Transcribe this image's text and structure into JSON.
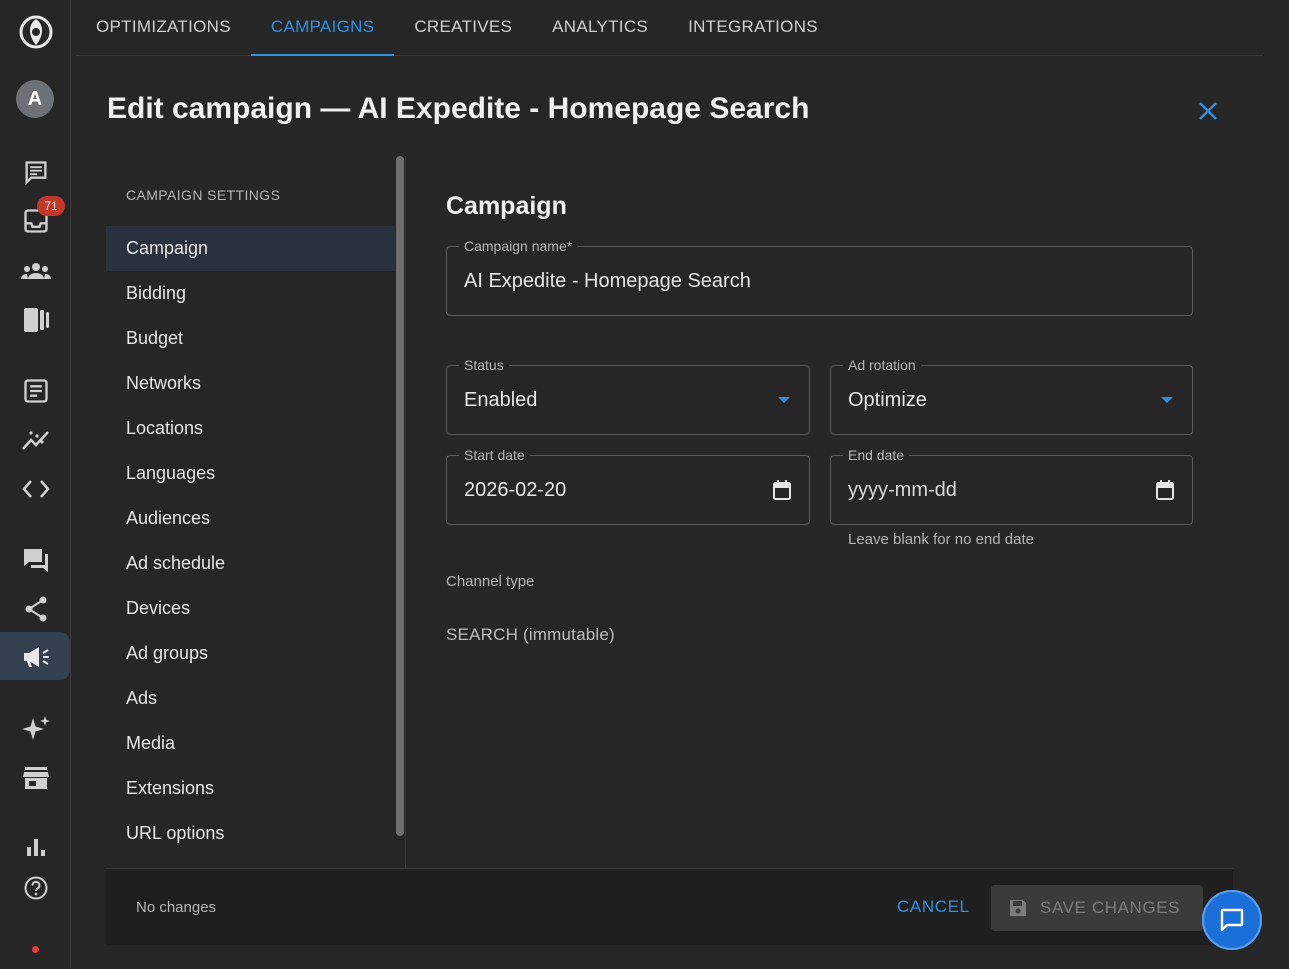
{
  "rail": {
    "avatar_letter": "A",
    "inbox_badge": "71"
  },
  "topnav": {
    "tabs": [
      {
        "label": "OPTIMIZATIONS"
      },
      {
        "label": "CAMPAIGNS"
      },
      {
        "label": "CREATIVES"
      },
      {
        "label": "ANALYTICS"
      },
      {
        "label": "INTEGRATIONS"
      }
    ],
    "active_tab": "CAMPAIGNS"
  },
  "page": {
    "title": "Edit campaign — AI Expedite - Homepage Search"
  },
  "menu": {
    "heading": "CAMPAIGN SETTINGS",
    "items": [
      {
        "label": "Campaign"
      },
      {
        "label": "Bidding"
      },
      {
        "label": "Budget"
      },
      {
        "label": "Networks"
      },
      {
        "label": "Locations"
      },
      {
        "label": "Languages"
      },
      {
        "label": "Audiences"
      },
      {
        "label": "Ad schedule"
      },
      {
        "label": "Devices"
      },
      {
        "label": "Ad groups"
      },
      {
        "label": "Ads"
      },
      {
        "label": "Media"
      },
      {
        "label": "Extensions"
      },
      {
        "label": "URL options"
      }
    ],
    "active_item": "Campaign"
  },
  "form": {
    "section_title": "Campaign",
    "campaign_name": {
      "label": "Campaign name*",
      "value": "AI Expedite - Homepage Search"
    },
    "status": {
      "label": "Status",
      "value": "Enabled"
    },
    "ad_rotation": {
      "label": "Ad rotation",
      "value": "Optimize"
    },
    "start_date": {
      "label": "Start date",
      "value": "2026-02-20"
    },
    "end_date": {
      "label": "End date",
      "placeholder": "yyyy-mm-dd",
      "helper": "Leave blank for no end date"
    },
    "channel_type": {
      "label": "Channel type",
      "value": "SEARCH (immutable)"
    }
  },
  "footer": {
    "status": "No changes",
    "cancel_label": "CANCEL",
    "save_label": "SAVE CHANGES"
  },
  "colors": {
    "accent": "#2f8fe0",
    "background": "#262626",
    "badge": "#c0392b",
    "fab": "#1b6fd8"
  },
  "icons": [
    "app-logo-icon",
    "avatar",
    "notes-icon",
    "inbox-icon",
    "people-icon",
    "devices-icon",
    "article-icon",
    "trend-icon",
    "code-icon",
    "forum-icon",
    "share-icon",
    "campaign-icon",
    "sparkle-icon",
    "store-icon",
    "bar-chart-icon",
    "help-icon",
    "close-icon",
    "chevron-down-icon",
    "calendar-icon",
    "save-icon",
    "chat-icon"
  ]
}
